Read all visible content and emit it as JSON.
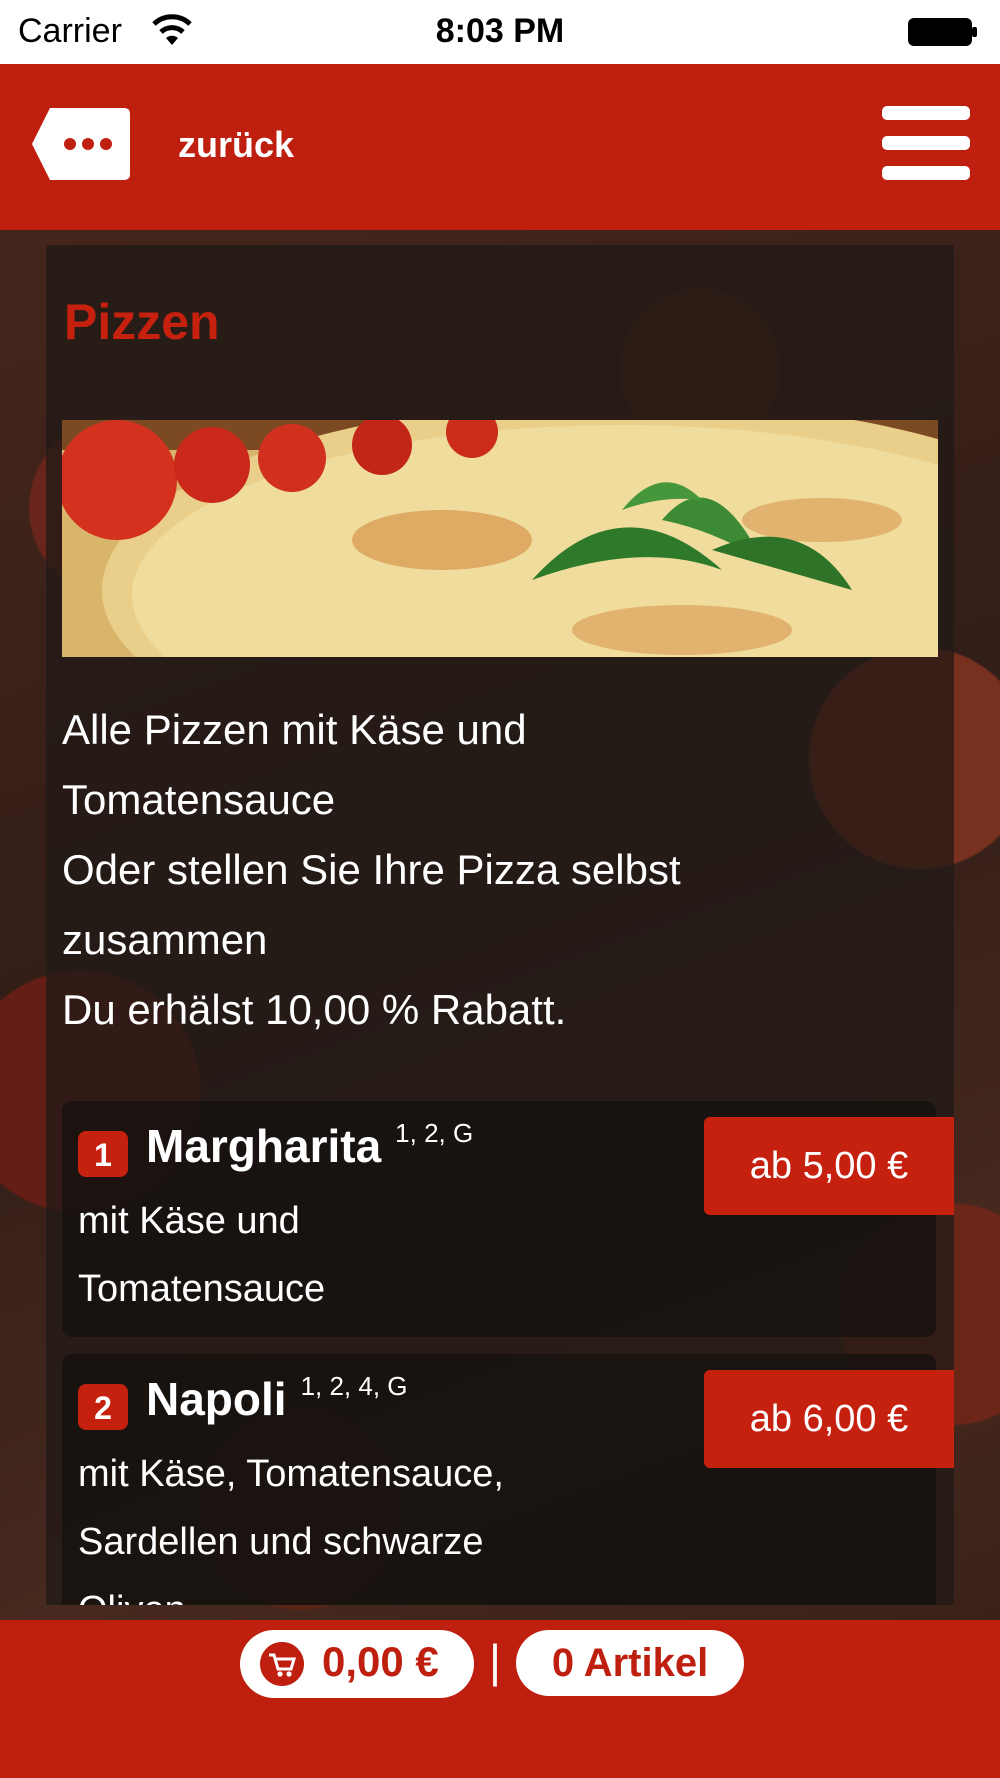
{
  "statusbar": {
    "carrier": "Carrier",
    "time": "8:03 PM"
  },
  "header": {
    "back_label": "zurück",
    "back_icon": "ellipsis-tag-icon",
    "menu_icon": "hamburger-menu-icon",
    "color": "#bf1f0f"
  },
  "category": {
    "title": "Pizzen",
    "description_lines": [
      "Alle Pizzen mit Käse und",
      "Tomatensauce",
      "Oder stellen Sie Ihre Pizza selbst",
      "zusammen",
      "Du erhälst 10,00 % Rabatt."
    ]
  },
  "items": [
    {
      "number": "1",
      "name": "Margharita",
      "additives": "1, 2, G",
      "description_lines": [
        "mit Käse und",
        "Tomatensauce"
      ],
      "price": "ab 5,00 €"
    },
    {
      "number": "2",
      "name": "Napoli",
      "additives": "1, 2, 4, G",
      "description_lines": [
        "mit Käse, Tomatensauce,",
        "Sardellen und schwarze",
        "Oliven"
      ],
      "price": "ab 6,00 €"
    }
  ],
  "footer": {
    "cart_total": "0,00 €",
    "separator": "|",
    "article_count": "0 Artikel",
    "cart_icon": "shopping-cart-icon"
  },
  "colors": {
    "accent": "#c6200f",
    "header_bg": "#bf1f0f"
  }
}
